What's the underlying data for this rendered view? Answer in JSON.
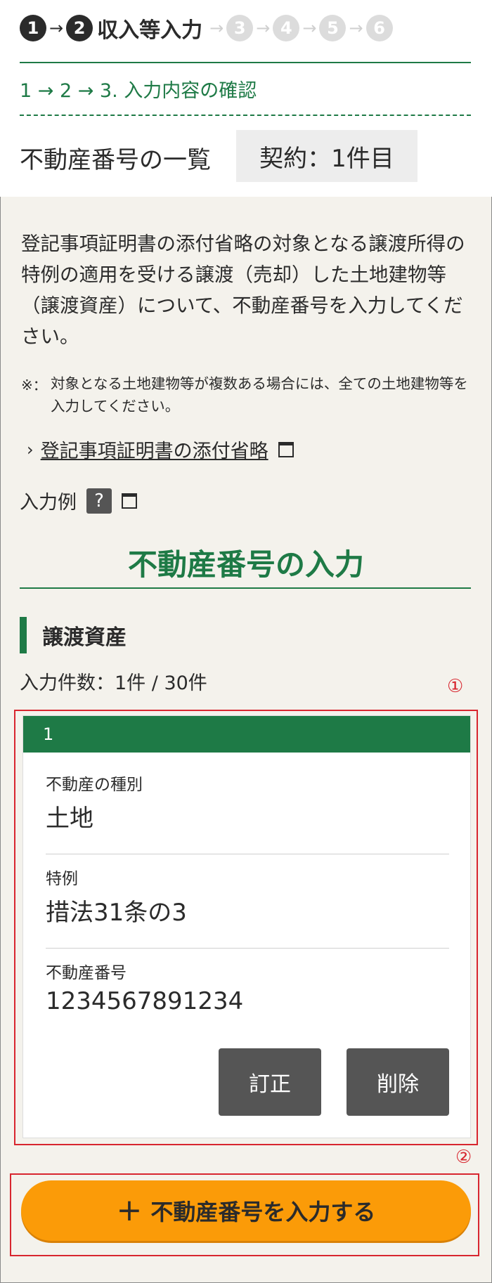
{
  "steps": {
    "s1": "1",
    "s2": "2",
    "title": "収入等入力",
    "s3": "3",
    "s4": "4",
    "s5": "5",
    "s6": "6"
  },
  "sub_steps": "1 → 2 → 3. 入力内容の確認",
  "list_title": "不動産番号の一覧",
  "contract_badge": "契約：1件目",
  "description": "登記事項証明書の添付省略の対象となる譲渡所得の特例の適用を受ける譲渡（売却）した土地建物等（譲渡資産）について、不動産番号を入力してください。",
  "note_mark": "※：",
  "note_text": "対象となる土地建物等が複数ある場合には、全ての土地建物等を入力してください。",
  "link_text": "登記事項証明書の添付省略",
  "example_label": "入力例",
  "help_glyph": "?",
  "section_title": "不動産番号の入力",
  "asset_heading": "譲渡資産",
  "count_text": "入力件数：1件  /  30件",
  "annotation_1": "①",
  "annotation_2": "②",
  "card": {
    "number": "1",
    "type_label": "不動産の種別",
    "type_value": "土地",
    "special_label": "特例",
    "special_value": "措法31条の3",
    "number_label": "不動産番号",
    "number_value": "1234567891234",
    "edit_button": "訂正",
    "delete_button": "削除"
  },
  "add_button": {
    "plus": "+",
    "label": "不動産番号を入力する"
  },
  "colors": {
    "brand_green": "#1e7a46",
    "accent_orange": "#fb9b08",
    "annotation_red": "#d8262f",
    "background": "#f4f2ec"
  }
}
